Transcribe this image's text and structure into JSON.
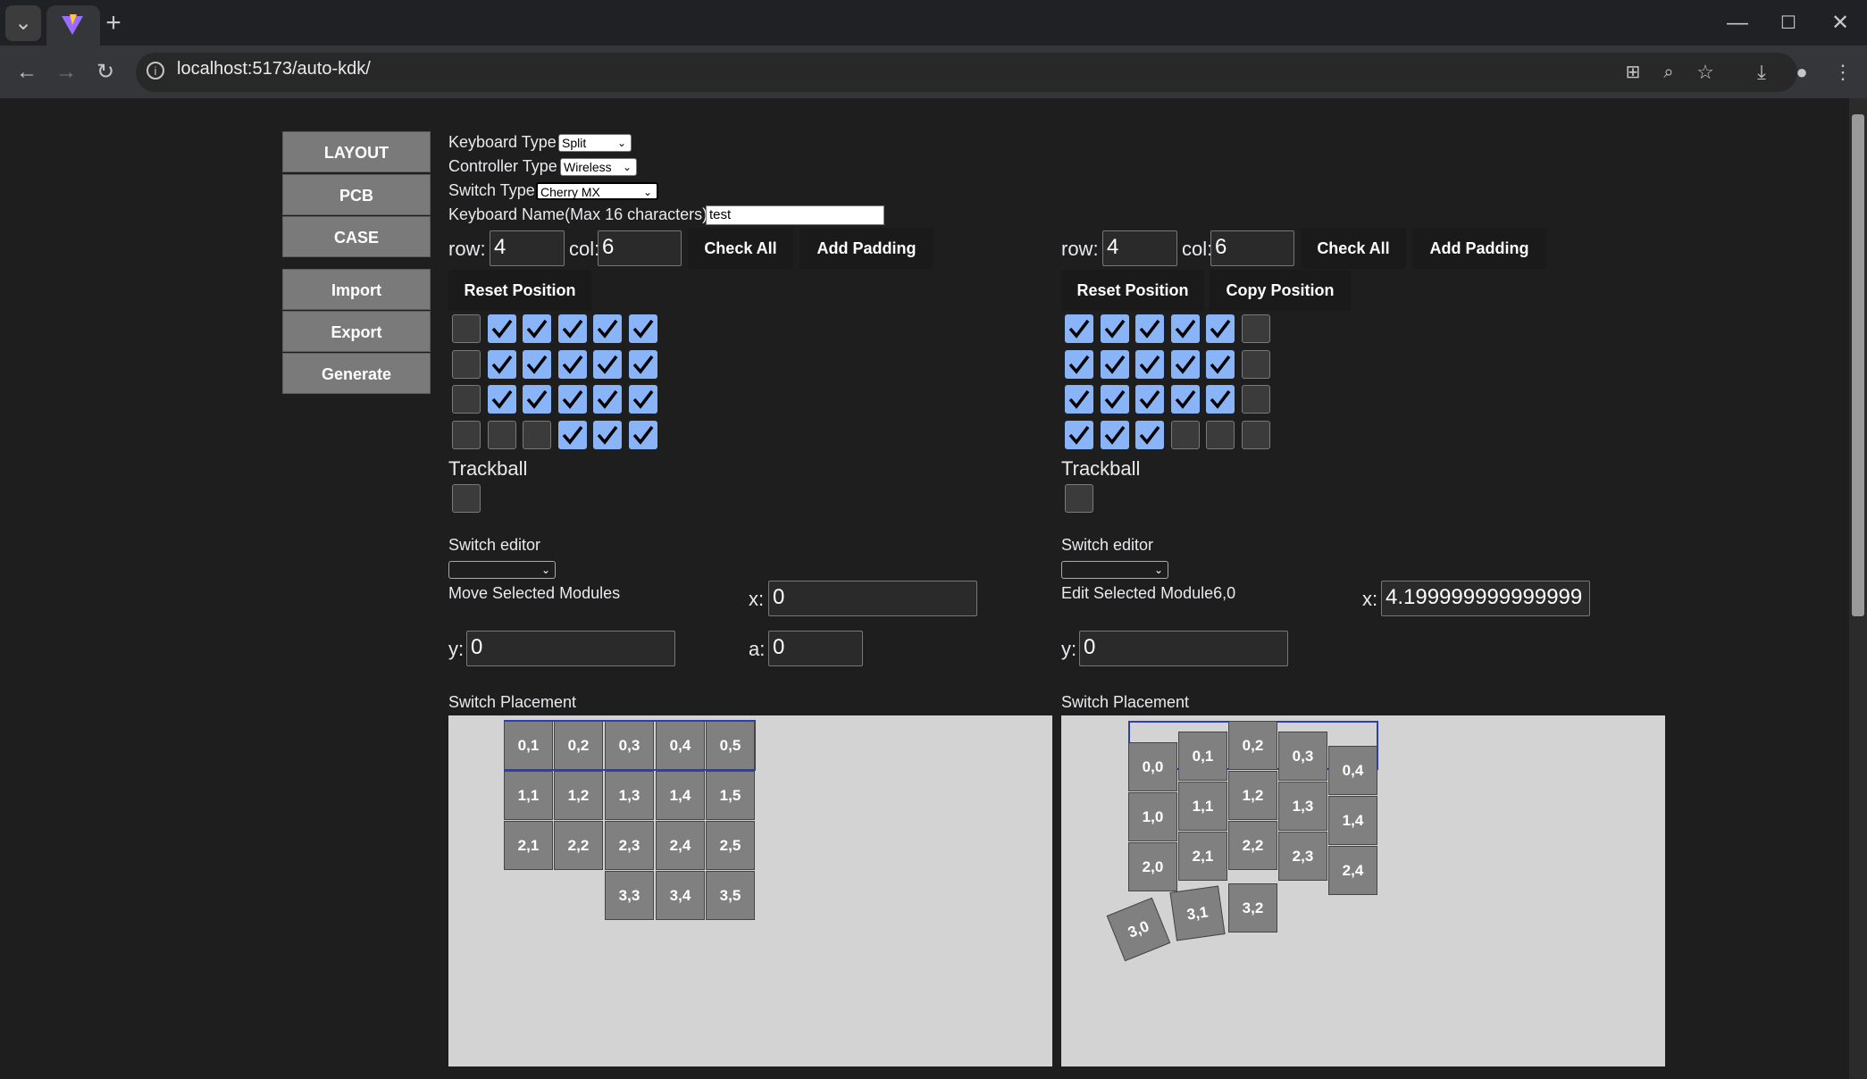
{
  "browser": {
    "tab_dropdown_icon": "chevron-down-icon",
    "new_tab_label": "+",
    "url": "localhost:5173/auto-kdk/",
    "window_controls": [
      "minimize-icon",
      "maximize-icon",
      "close-icon"
    ]
  },
  "nav": {
    "layout": "LAYOUT",
    "pcb": "PCB",
    "case": "CASE",
    "import": "Import",
    "export": "Export",
    "generate": "Generate"
  },
  "settings": {
    "keyboard_type_label": "Keyboard Type",
    "keyboard_type_value": "Split",
    "controller_type_label": "Controller Type",
    "controller_type_value": "Wireless",
    "switch_type_label": "Switch Type",
    "switch_type_value": "Cherry MX",
    "keyboard_name_label": "Keyboard Name(Max 16 characters)",
    "keyboard_name_value": "test"
  },
  "left": {
    "row_label": "row:",
    "row_value": "4",
    "col_label": "col:",
    "col_value": "6",
    "check_all": "Check All",
    "add_padding": "Add Padding",
    "reset_position": "Reset Position",
    "grid": [
      [
        false,
        true,
        true,
        true,
        true,
        true
      ],
      [
        false,
        true,
        true,
        true,
        true,
        true
      ],
      [
        false,
        true,
        true,
        true,
        true,
        true
      ],
      [
        false,
        false,
        false,
        true,
        true,
        true
      ]
    ],
    "trackball_label": "Trackball",
    "trackball_checked": false,
    "switch_editor_label": "Switch editor",
    "switch_editor_value": "",
    "module_label": "Move Selected Modules",
    "x_label": "x:",
    "x_value": "0",
    "y_label": "y:",
    "y_value": "0",
    "a_label": "a:",
    "a_value": "0",
    "placement_label": "Switch Placement",
    "keys": [
      "0,1",
      "0,2",
      "0,3",
      "0,4",
      "0,5",
      "1,1",
      "1,2",
      "1,3",
      "1,4",
      "1,5",
      "2,1",
      "2,2",
      "2,3",
      "2,4",
      "2,5",
      "3,3",
      "3,4",
      "3,5"
    ]
  },
  "right": {
    "row_label": "row:",
    "row_value": "4",
    "col_label": "col:",
    "col_value": "6",
    "check_all": "Check All",
    "add_padding": "Add Padding",
    "reset_position": "Reset Position",
    "copy_position": "Copy Position",
    "grid": [
      [
        true,
        true,
        true,
        true,
        true,
        false
      ],
      [
        true,
        true,
        true,
        true,
        true,
        false
      ],
      [
        true,
        true,
        true,
        true,
        true,
        false
      ],
      [
        true,
        true,
        true,
        false,
        false,
        false
      ]
    ],
    "trackball_label": "Trackball",
    "trackball_checked": false,
    "switch_editor_label": "Switch editor",
    "switch_editor_value": "",
    "module_label": "Edit Selected Module6,0",
    "x_label": "x:",
    "x_value": "4.199999999999999",
    "y_label": "y:",
    "y_value": "0",
    "placement_label": "Switch Placement",
    "keys": [
      "0,0",
      "0,1",
      "0,2",
      "0,3",
      "0,4",
      "1,0",
      "1,1",
      "1,2",
      "1,3",
      "1,4",
      "2,0",
      "2,1",
      "2,2",
      "2,3",
      "2,4",
      "3,0",
      "3,1",
      "3,2"
    ]
  }
}
